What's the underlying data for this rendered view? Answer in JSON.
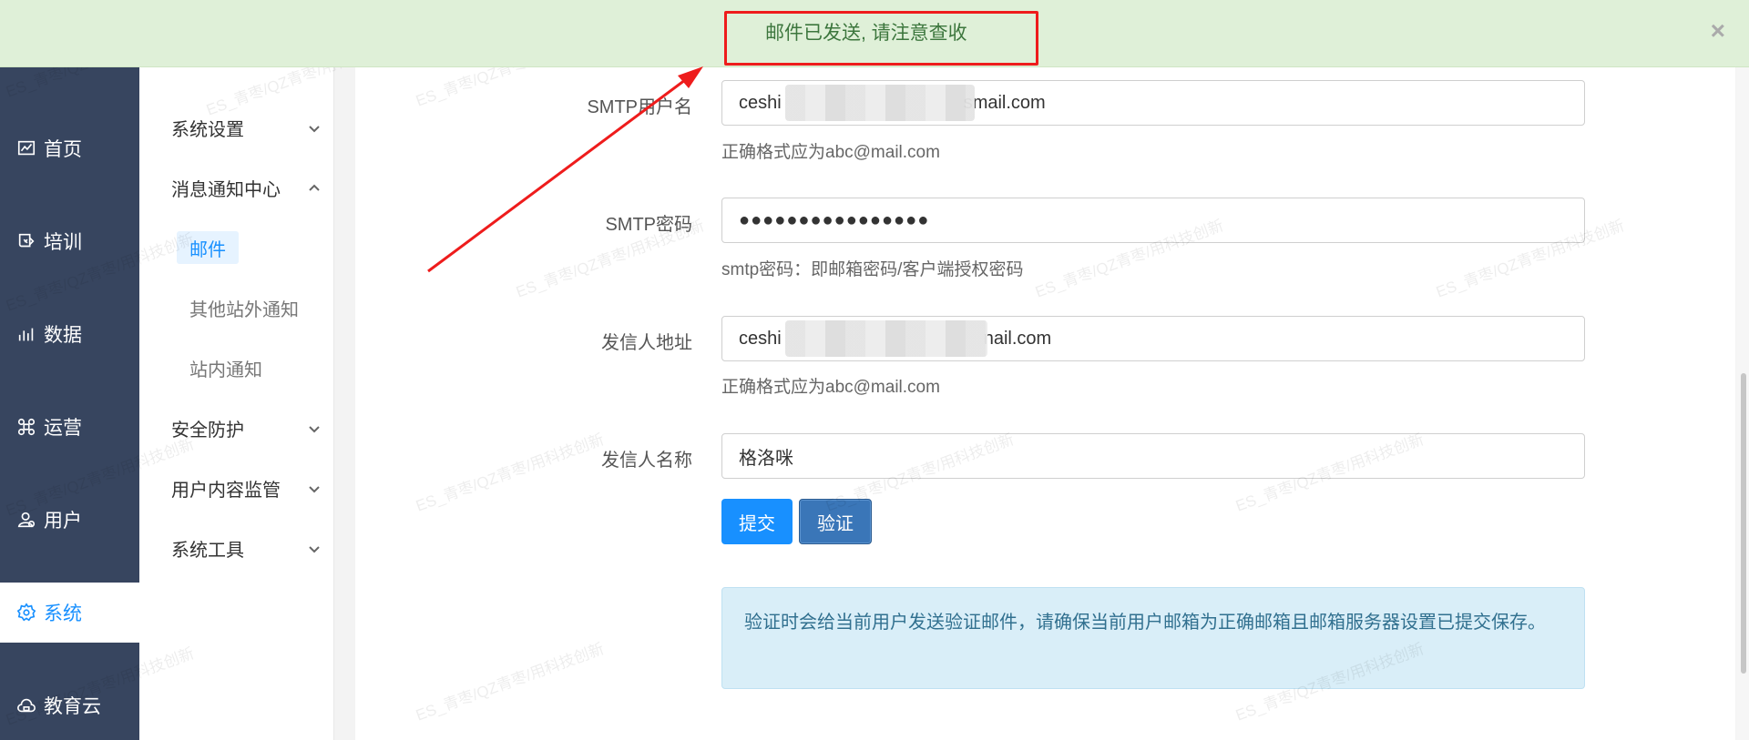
{
  "alert": {
    "message": "邮件已发送, 请注意查收",
    "close": "×"
  },
  "nav_main": [
    {
      "label": "首页",
      "icon": "chart-icon"
    },
    {
      "label": "培训",
      "icon": "book-icon"
    },
    {
      "label": "数据",
      "icon": "bar-chart-icon"
    },
    {
      "label": "运营",
      "icon": "command-icon"
    },
    {
      "label": "用户",
      "icon": "user-icon"
    },
    {
      "label": "系统",
      "icon": "gear-icon",
      "active": true
    },
    {
      "label": "教育云",
      "icon": "cloud-icon"
    }
  ],
  "nav_sub": {
    "groups": [
      {
        "label": "系统设置",
        "expanded": false
      },
      {
        "label": "消息通知中心",
        "expanded": true
      },
      {
        "label": "安全防护",
        "expanded": false
      },
      {
        "label": "用户内容监管",
        "expanded": false
      },
      {
        "label": "系统工具",
        "expanded": false
      }
    ],
    "children": [
      {
        "label": "邮件",
        "active": true
      },
      {
        "label": "其他站外通知"
      },
      {
        "label": "站内通知"
      }
    ]
  },
  "form": {
    "smtp_user": {
      "label": "SMTP用户名",
      "value_start": "ceshi",
      "value_end": "smail.com",
      "hint": "正确格式应为abc@mail.com"
    },
    "smtp_pass": {
      "label": "SMTP密码",
      "value": "●●●●●●●●●●●●●●●●",
      "hint": "smtp密码：即邮箱密码/客户端授权密码"
    },
    "sender_addr": {
      "label": "发信人地址",
      "value_start": "ceshi",
      "value_end": "nail.com",
      "hint": "正确格式应为abc@mail.com"
    },
    "sender_name": {
      "label": "发信人名称",
      "value": "格洛咪"
    },
    "submit_label": "提交",
    "verify_label": "验证",
    "info": "验证时会给当前用户发送验证邮件，请确保当前用户邮箱为正确邮箱且邮箱服务器设置已提交保存。"
  },
  "watermark": "ES_青枣/QZ青枣/用科技创新",
  "colors": {
    "nav_dark": "#37455f",
    "accent": "#1890ff",
    "alert_bg": "#dff0d8",
    "alert_text": "#3c763d",
    "annotation": "#ee1c1c"
  }
}
